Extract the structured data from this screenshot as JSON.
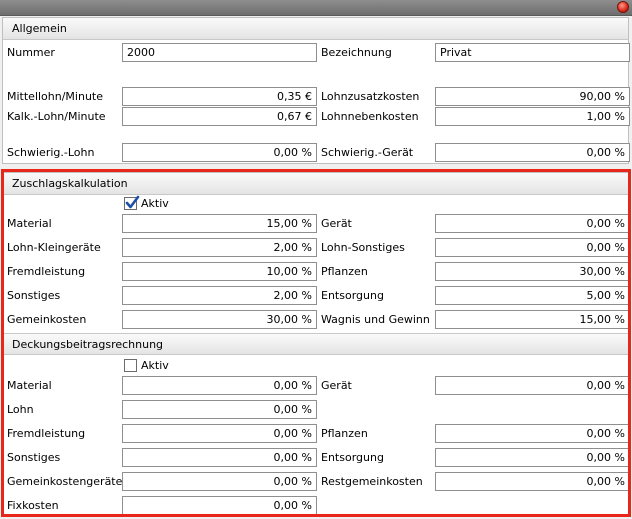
{
  "allgemein": {
    "title": "Allgemein",
    "nummer_label": "Nummer",
    "nummer": "2000",
    "bezeichnung_label": "Bezeichnung",
    "bezeichnung": "Privat",
    "mittellohn_label": "Mittellohn/Minute",
    "mittellohn": "0,35 €",
    "lohnzusatz_label": "Lohnzusatzkosten",
    "lohnzusatz": "90,00 %",
    "kalk_label": "Kalk.-Lohn/Minute",
    "kalk": "0,67 €",
    "lohnneben_label": "Lohnnebenkosten",
    "lohnneben": "1,00 %",
    "schwierig_lohn_label": "Schwierig.-Lohn",
    "schwierig_lohn": "0,00 %",
    "schwierig_geraet_label": "Schwierig.-Gerät",
    "schwierig_geraet": "0,00 %"
  },
  "zuschlag": {
    "title": "Zuschlagskalkulation",
    "aktiv_label": "Aktiv",
    "aktiv_checked": true,
    "rows": [
      {
        "left_label": "Material",
        "left": "15,00 %",
        "right_label": "Gerät",
        "right": "0,00 %"
      },
      {
        "left_label": "Lohn-Kleingeräte",
        "left": "2,00 %",
        "right_label": "Lohn-Sonstiges",
        "right": "0,00 %"
      },
      {
        "left_label": "Fremdleistung",
        "left": "10,00 %",
        "right_label": "Pflanzen",
        "right": "30,00 %"
      },
      {
        "left_label": "Sonstiges",
        "left": "2,00 %",
        "right_label": "Entsorgung",
        "right": "5,00 %"
      },
      {
        "left_label": "Gemeinkosten",
        "left": "30,00 %",
        "right_label": "Wagnis und Gewinn",
        "right": "15,00 %"
      }
    ]
  },
  "deckung": {
    "title": "Deckungsbeitragsrechnung",
    "aktiv_label": "Aktiv",
    "aktiv_checked": false,
    "rows": [
      {
        "left_label": "Material",
        "left": "0,00 %",
        "right_label": "Gerät",
        "right": "0,00 %"
      },
      {
        "left_label": "Lohn",
        "left": "0,00 %",
        "right_label": "",
        "right": ""
      },
      {
        "left_label": "Fremdleistung",
        "left": "0,00 %",
        "right_label": "Pflanzen",
        "right": "0,00 %"
      },
      {
        "left_label": "Sonstiges",
        "left": "0,00 %",
        "right_label": "Entsorgung",
        "right": "0,00 %"
      },
      {
        "left_label": "Gemeinkostengeräte",
        "left": "0,00 %",
        "right_label": "Restgemeinkosten",
        "right": "0,00 %"
      },
      {
        "left_label": "Fixkosten",
        "left": "0,00 %",
        "right_label": "",
        "right": ""
      }
    ]
  },
  "colors": {
    "highlight": "#e8261a",
    "close": "#d8281a"
  }
}
